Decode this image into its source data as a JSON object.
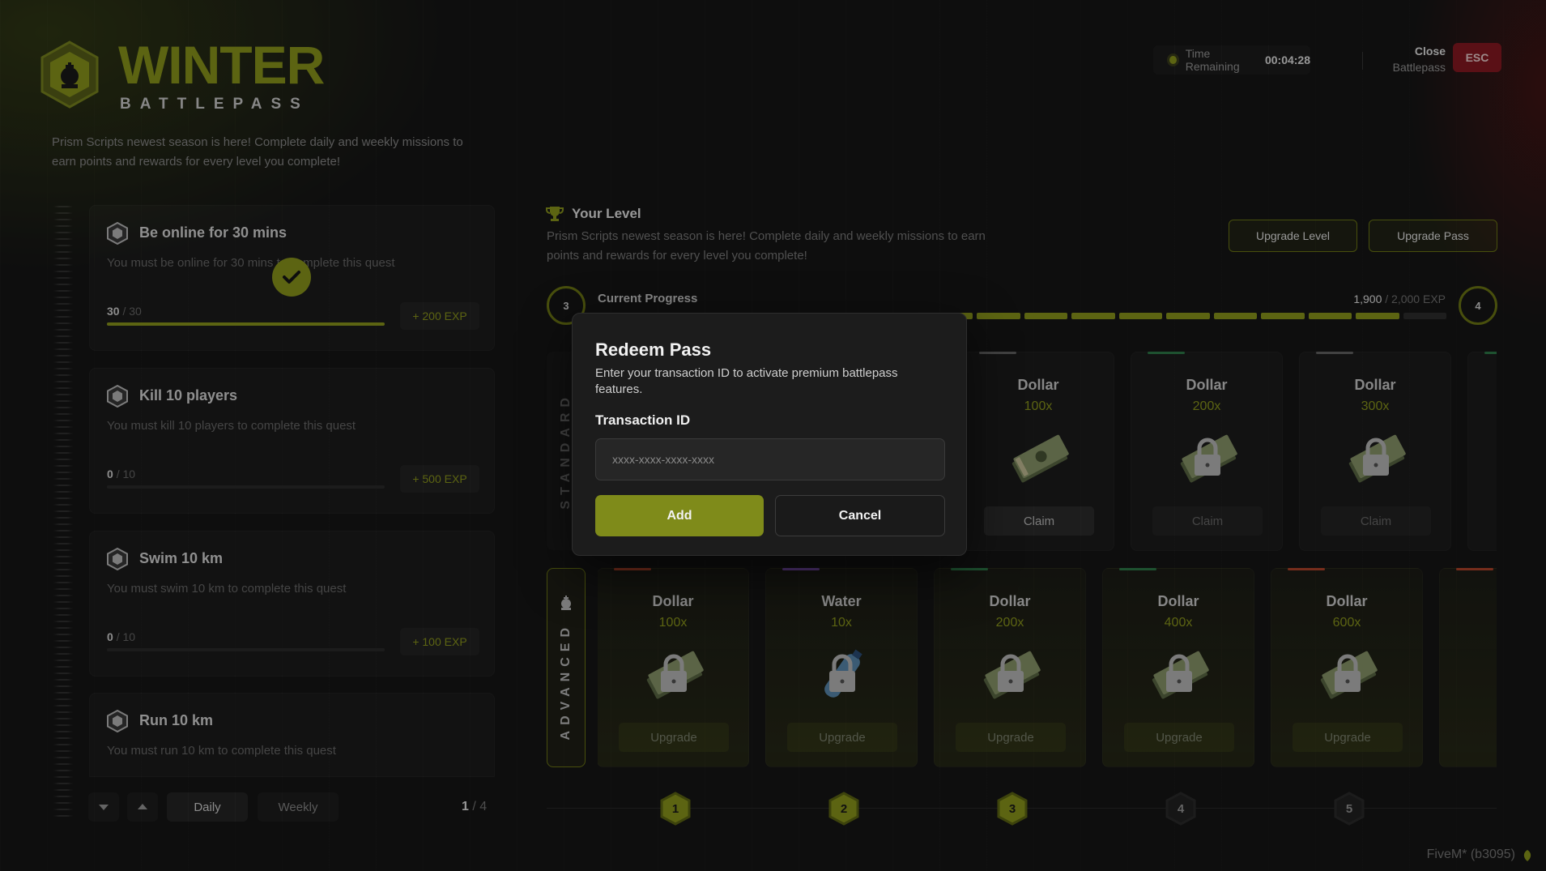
{
  "header": {
    "title": "WINTER",
    "subtitle": "BATTLEPASS",
    "description": "Prism Scripts newest season is here! Complete daily and weekly missions to earn points and rewards for every level you complete!",
    "timer_label": "Time Remaining",
    "timer_value": "00:04:28",
    "close_label": "Close",
    "close_sub": "Battlepass",
    "esc_label": "ESC"
  },
  "quests": [
    {
      "title": "Be online for 30 mins",
      "desc": "You must be online for 30 mins to complete this quest",
      "current": "30",
      "total": "/ 30",
      "progress": 1.0,
      "reward": "+ 200 EXP",
      "completed": true
    },
    {
      "title": "Kill 10 players",
      "desc": "You must kill 10 players to complete this quest",
      "current": "0",
      "total": "/ 10",
      "progress": 0.0,
      "reward": "+ 500 EXP",
      "completed": false
    },
    {
      "title": "Swim 10 km",
      "desc": "You must swim 10 km to complete this quest",
      "current": "0",
      "total": "/ 10",
      "progress": 0.0,
      "reward": "+ 100 EXP",
      "completed": false
    },
    {
      "title": "Run 10 km",
      "desc": "You must run 10 km to complete this quest",
      "current": "",
      "total": "",
      "progress": 0.0,
      "reward": "",
      "completed": false
    }
  ],
  "quest_nav": {
    "daily_label": "Daily",
    "weekly_label": "Weekly",
    "page_current": "1",
    "page_total": "/ 4"
  },
  "level": {
    "title": "Your Level",
    "description": "Prism Scripts newest season is here! Complete daily and weekly missions to earn points and rewards for every level you complete!",
    "upgrade_level_label": "Upgrade Level",
    "upgrade_pass_label": "Upgrade Pass",
    "current_level": "3",
    "next_level": "4",
    "progress_label": "Current Progress",
    "exp_current": "1,900",
    "exp_total": "/ 2,000 EXP",
    "progress": 0.95
  },
  "rows": {
    "standard_label": "STANDARD",
    "advanced_label": "ADVANCED"
  },
  "standard_rewards": [
    {
      "name": "Dollar",
      "amount": "100x",
      "button": "Claim",
      "locked": false,
      "accent": "#666666"
    },
    {
      "name": "Dollar",
      "amount": "200x",
      "button": "Claim",
      "locked": true,
      "accent": "#2e7d4a"
    },
    {
      "name": "Dollar",
      "amount": "300x",
      "button": "Claim",
      "locked": true,
      "accent": "#666666"
    }
  ],
  "advanced_rewards": [
    {
      "name": "Dollar",
      "amount": "100x",
      "button": "Upgrade",
      "item": "money",
      "accent": "#b5452b"
    },
    {
      "name": "Water",
      "amount": "10x",
      "button": "Upgrade",
      "item": "water",
      "accent": "#7b4fb3"
    },
    {
      "name": "Dollar",
      "amount": "200x",
      "button": "Upgrade",
      "item": "money",
      "accent": "#2e7d4a"
    },
    {
      "name": "Dollar",
      "amount": "400x",
      "button": "Upgrade",
      "item": "money",
      "accent": "#2e7d4a"
    },
    {
      "name": "Dollar",
      "amount": "600x",
      "button": "Upgrade",
      "item": "money",
      "accent": "#b5452b"
    }
  ],
  "level_markers": [
    "1",
    "2",
    "3",
    "4",
    "5"
  ],
  "modal": {
    "title": "Redeem Pass",
    "description": "Enter your transaction ID to activate premium battlepass features.",
    "field_label": "Transaction ID",
    "placeholder": "xxxx-xxxx-xxxx-xxxx",
    "add_label": "Add",
    "cancel_label": "Cancel"
  },
  "footer": {
    "build": "FiveM* (b3095)"
  },
  "colors": {
    "accent": "#8e9a1d",
    "danger": "#8b1a22",
    "background": "#161616"
  }
}
